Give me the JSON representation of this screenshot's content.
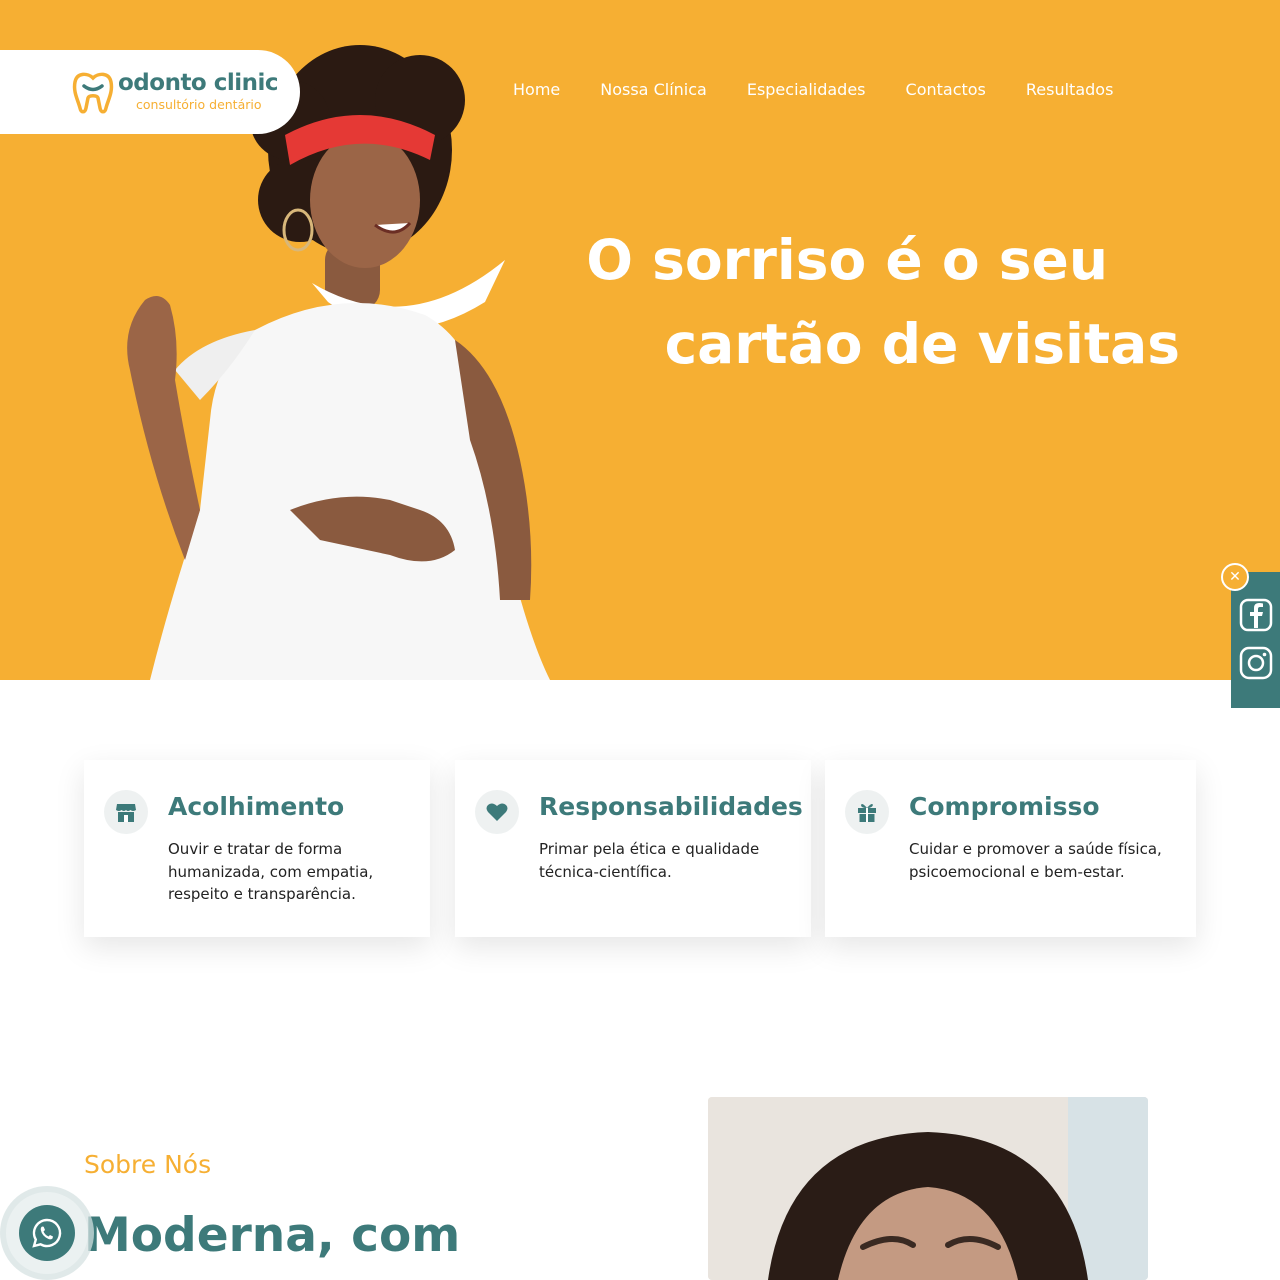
{
  "brand": {
    "name": "odonto clinic",
    "tagline": "consultório dentário",
    "primary_color": "#3D7A7A",
    "accent_color": "#F6AF33"
  },
  "nav": {
    "items": [
      "Home",
      "Nossa Clínica",
      "Especialidades",
      "Contactos",
      "Resultados"
    ]
  },
  "hero": {
    "headline_line1": "O sorriso é o seu",
    "headline_line2": "cartão de visitas"
  },
  "social": {
    "close_icon": "close-icon",
    "items": [
      "facebook-icon",
      "instagram-icon"
    ]
  },
  "features": [
    {
      "icon": "store-icon",
      "title": "Acolhimento",
      "text": "Ouvir e tratar de forma humanizada, com empatia, respeito e transparência."
    },
    {
      "icon": "heart-icon",
      "title": "Responsabilidades",
      "text": "Primar pela ética e qualidade técnica-científica."
    },
    {
      "icon": "gift-icon",
      "title": "Compromisso",
      "text": "Cuidar e promover a saúde física, psicoemocional e bem-estar."
    }
  ],
  "about": {
    "kicker": "Sobre Nós",
    "title": "Moderna, com"
  },
  "whatsapp": {
    "icon": "whatsapp-icon"
  }
}
